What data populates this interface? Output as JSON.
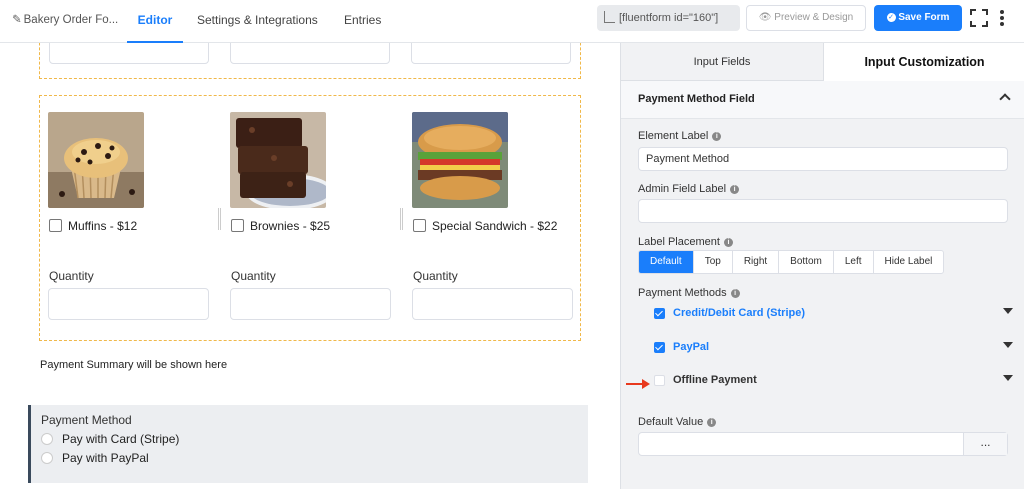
{
  "header": {
    "form_name": "Bakery Order Fo...",
    "tabs": [
      "Editor",
      "Settings & Integrations",
      "Entries"
    ],
    "shortcode": "[fluentform id=\"160\"]",
    "preview_label": "Preview & Design",
    "save_label": "Save Form"
  },
  "canvas": {
    "products": [
      {
        "label": "Muffins - $12",
        "qty_label": "Quantity"
      },
      {
        "label": "Brownies - $25",
        "qty_label": "Quantity"
      },
      {
        "label": "Special Sandwich - $22",
        "qty_label": "Quantity"
      }
    ],
    "payment_summary": "Payment Summary will be shown here",
    "payment_method": {
      "title": "Payment Method",
      "options": [
        "Pay with Card (Stripe)",
        "Pay with PayPal"
      ]
    }
  },
  "sidebar": {
    "tabs": [
      "Input Fields",
      "Input Customization"
    ],
    "section_title": "Payment Method Field",
    "element_label": {
      "label": "Element Label",
      "value": "Payment Method"
    },
    "admin_label": {
      "label": "Admin Field Label",
      "value": ""
    },
    "label_placement": {
      "label": "Label Placement",
      "options": [
        "Default",
        "Top",
        "Right",
        "Bottom",
        "Left",
        "Hide Label"
      ],
      "selected": "Default"
    },
    "payment_methods": {
      "label": "Payment Methods",
      "items": [
        {
          "label": "Credit/Debit Card (Stripe)",
          "checked": true
        },
        {
          "label": "PayPal",
          "checked": true
        },
        {
          "label": "Offline Payment",
          "checked": false
        }
      ]
    },
    "default_value": {
      "label": "Default Value",
      "value": "",
      "button": "..."
    }
  },
  "colors": {
    "accent": "#1a7efb",
    "dashed": "#f0b849",
    "arrow": "#e8391d"
  },
  "icons": [
    "edit-icon",
    "shortcode-icon",
    "eye-icon",
    "save-icon",
    "fullscreen-icon",
    "more-icon",
    "help-icon",
    "chevron-up-icon",
    "caret-down-icon",
    "arrow-right-icon"
  ]
}
